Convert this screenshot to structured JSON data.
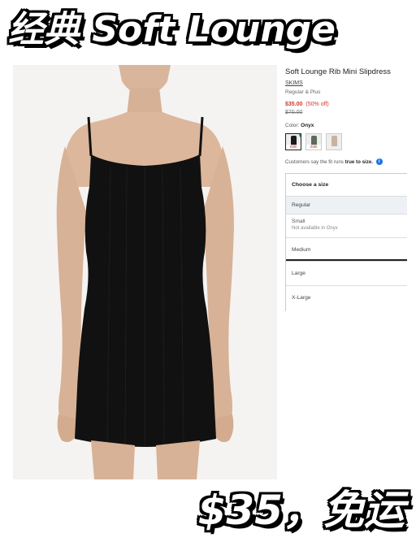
{
  "overlay": {
    "headline": "经典 Soft Lounge",
    "price_note": "$35，免运"
  },
  "product": {
    "title": "Soft Lounge Rib Mini Slipdress",
    "brand": "SKIMS",
    "variant_type": "Regular & Plus",
    "sale_price": "$35.00",
    "discount": "(50% off)",
    "original_price": "$70.00",
    "color_label": "Color:",
    "color_value": "Onyx",
    "swatches": [
      {
        "name": "Onyx",
        "color": "#1a1a1a",
        "tag": "Sale",
        "selected": true
      },
      {
        "name": "Green",
        "color": "#5d6b5a",
        "tag": "Sale",
        "selected": false
      },
      {
        "name": "Beige",
        "color": "#c9b29f",
        "tag": "",
        "selected": false
      }
    ],
    "fit_note_prefix": "Customers say the fit runs",
    "fit_note_value": "true to size."
  },
  "size_selector": {
    "header": "Choose a size",
    "options": {
      "regular": "Regular",
      "small": "Small",
      "small_note": "Not available in Onyx",
      "medium": "Medium",
      "large": "Large",
      "xlarge": "X-Large"
    }
  },
  "colors": {
    "sale_red": "#d0392b",
    "check_green": "#2e9e55",
    "info_blue": "#1a73e8"
  }
}
